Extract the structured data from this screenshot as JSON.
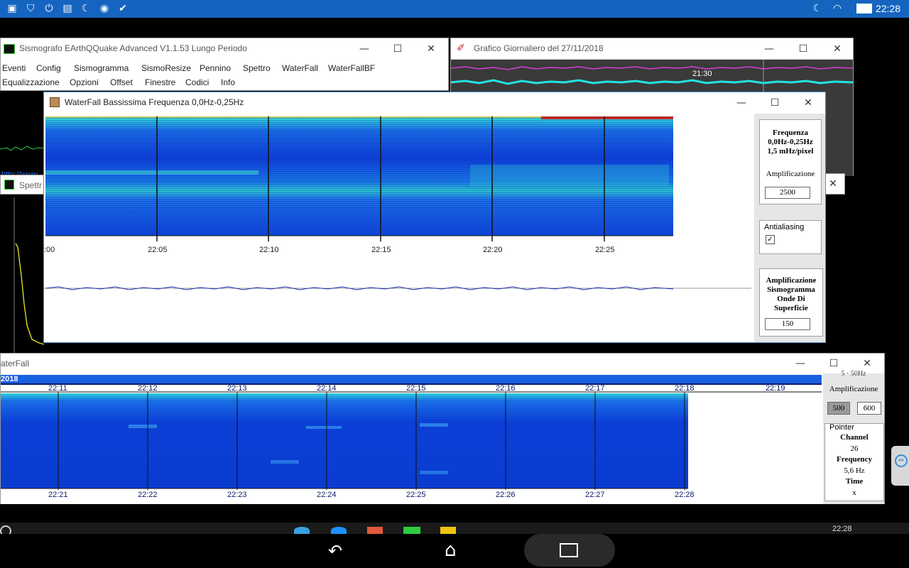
{
  "status_bar": {
    "time": "22:28",
    "icons_left": [
      "gallery-icon",
      "shield-icon",
      "power-icon",
      "file-icon",
      "moon-icon",
      "chat-icon",
      "check-icon"
    ],
    "icons_right": [
      "moon-icon",
      "wifi-icon",
      "battery-icon"
    ]
  },
  "main_window": {
    "title": "Sismografo  EArthQQuake Advanced V1.1.53  Lungo Periodo",
    "menu_row1": [
      "Eventi",
      "Config",
      "Sismogramma",
      "SismoResize",
      "Pennino",
      "Spettro",
      "WaterFall",
      "WaterFallBF"
    ],
    "menu_row2": [
      "Equalizzazione",
      "Opzioni",
      "Offset",
      "Finestre",
      "Codici",
      "Info"
    ]
  },
  "daily_window": {
    "title": "Grafico Giornaliero del 27/11/2018",
    "time_label": "21:30"
  },
  "spettro_window": {
    "title": "Spettr",
    "link": "http://www"
  },
  "waterfall_bf": {
    "title": "WaterFall Bassissima Frequenza 0,0Hz-0,25Hz",
    "time_ticks": [
      ":00",
      "22:05",
      "22:10",
      "22:15",
      "22:20",
      "22:25"
    ],
    "freq_group": {
      "line1": "Frequenza",
      "line2": "0,0Hz-0,25Hz",
      "line3": "1,5 mHz/pixel"
    },
    "amp_label": "Amplificazione",
    "amp_value": "2500",
    "antialiasing_label": "Antialiasing",
    "antialiasing_check": "✓",
    "seismo_group": {
      "line1": "Amplificazione",
      "line2": "Sismogramma",
      "line3": "Onde Di",
      "line4": "Superficie"
    },
    "seismo_amp_value": "150"
  },
  "waterfall": {
    "title": "aterFall",
    "year_label": "2018",
    "top_ticks": [
      "22:11",
      "22:12",
      "22:13",
      "22:14",
      "22:15",
      "22:16",
      "22:17",
      "22:18",
      "22:19"
    ],
    "bottom_ticks": [
      "22:21",
      "22:22",
      "22:23",
      "22:24",
      "22:25",
      "22:26",
      "22:27",
      "22:28"
    ],
    "side_header": "5 · 50Hz",
    "amp_label": "Amplificazione",
    "amp_value1": "500",
    "amp_value2": "600",
    "pointer_label": "Pointer",
    "channel_label": "Channel",
    "channel_value": "26",
    "frequency_label": "Frequency",
    "frequency_value": "5,6 Hz",
    "time_label": "Time",
    "time_value": "x"
  },
  "taskbar": {
    "time": "22:28"
  },
  "colors": {
    "status_blue": "#1565c0",
    "cyan_trace": "#22e3e3",
    "magenta_trace": "#d93cd9",
    "waterfall_blue": "#0b3fd6"
  }
}
